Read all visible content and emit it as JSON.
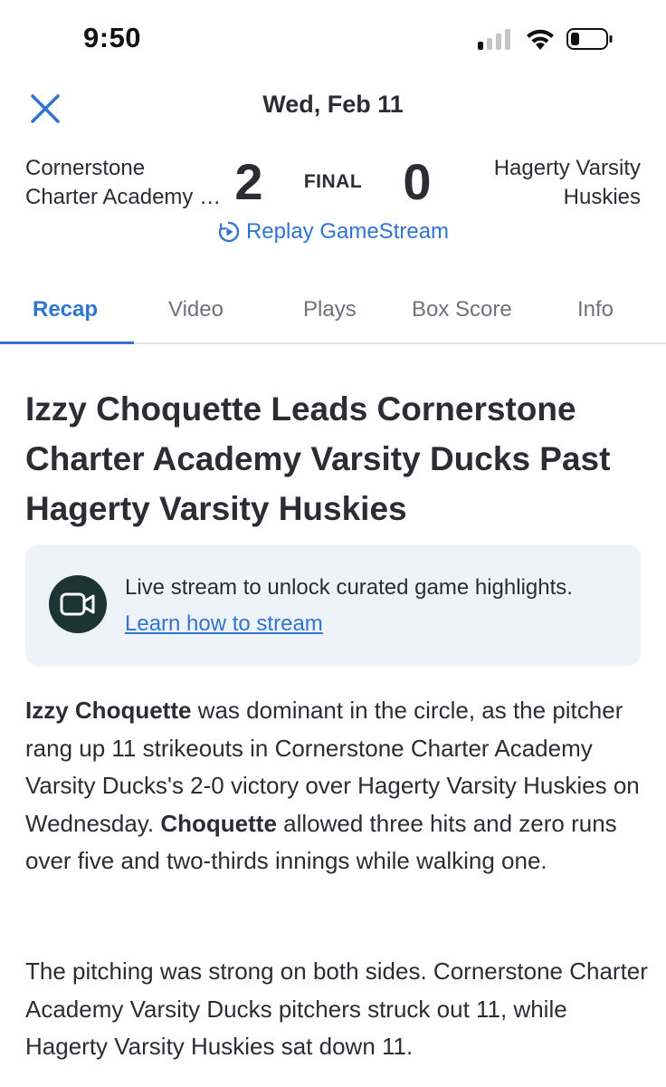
{
  "status_bar": {
    "time": "9:50"
  },
  "header": {
    "date": "Wed, Feb 11"
  },
  "scoreboard": {
    "home_team_line1": "Cornerstone",
    "home_team_line2": "Charter Academy Varsity Ducks",
    "home_score": "2",
    "status": "FINAL",
    "away_score": "0",
    "away_team_line1": "Hagerty Varsity",
    "away_team_line2": "Huskies",
    "replay_label": "Replay GameStream"
  },
  "tabs": [
    {
      "label": "Recap",
      "active": true
    },
    {
      "label": "Video",
      "active": false
    },
    {
      "label": "Plays",
      "active": false
    },
    {
      "label": "Box Score",
      "active": false
    },
    {
      "label": "Info",
      "active": false
    }
  ],
  "article": {
    "headline": "Izzy Choquette Leads Cornerstone Charter Academy Varsity Ducks Past Hagerty Varsity Huskies",
    "promo_text": "Live stream to unlock curated game highlights.",
    "promo_link": "Learn how to stream",
    "p1_bold1": "Izzy Choquette",
    "p1_text1": " was dominant in the circle, as the pitcher rang up 11 strikeouts in Cornerstone Charter Academy Varsity Ducks's 2-0 victory over Hagerty Varsity Huskies on Wednesday. ",
    "p1_bold2": "Choquette",
    "p1_text2": " allowed three hits and zero runs over five and two-thirds innings while walking one.",
    "p2_text": "The pitching was strong on both sides. Cornerstone Charter Academy Varsity Ducks pitchers struck out 11, while Hagerty Varsity Huskies sat down 11."
  },
  "colors": {
    "accent": "#2f74d0",
    "text": "#2b2d33",
    "muted_tab": "#6f7278",
    "promo_bg": "#eef3fa",
    "promo_icon_bg": "#1c3533"
  },
  "icons": {
    "close": "close-icon",
    "replay": "replay-icon",
    "video": "video-camera-icon"
  }
}
